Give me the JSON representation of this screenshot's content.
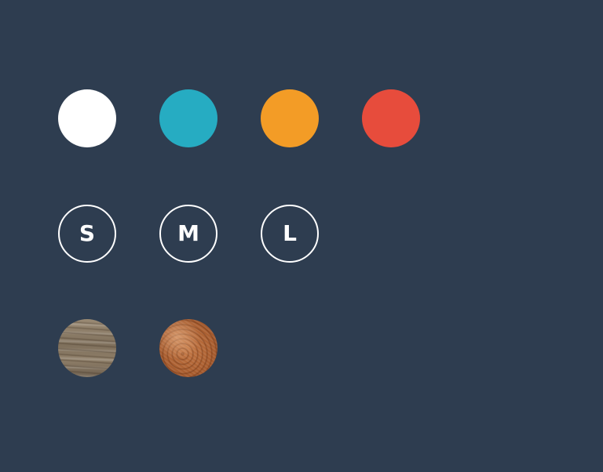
{
  "theme": {
    "background": "#2e3d50",
    "size_border": "#ffffff",
    "size_text": "#ffffff"
  },
  "colors": [
    {
      "name": "white",
      "hex": "#ffffff"
    },
    {
      "name": "teal",
      "hex": "#26acc2"
    },
    {
      "name": "orange",
      "hex": "#f39c26"
    },
    {
      "name": "red",
      "hex": "#e74c3c"
    }
  ],
  "sizes": [
    {
      "label": "S"
    },
    {
      "label": "M"
    },
    {
      "label": "L"
    }
  ],
  "materials": [
    {
      "name": "wood"
    },
    {
      "name": "leather"
    }
  ]
}
